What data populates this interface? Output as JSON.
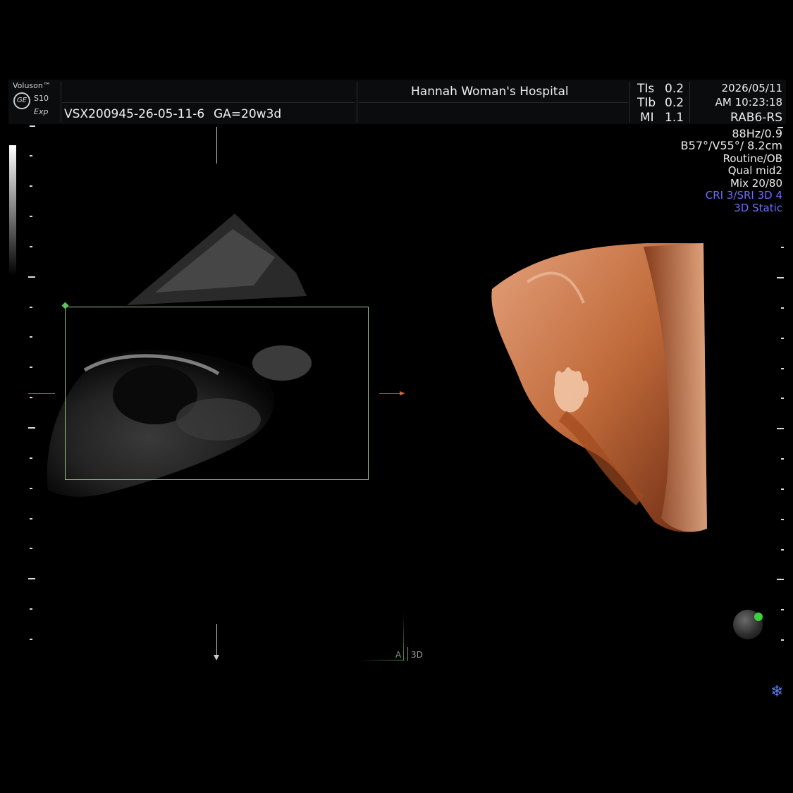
{
  "header": {
    "brand": "Voluson™",
    "model": "S10",
    "model_sub": "Exp",
    "logo": "GE",
    "patient_id": "VSX200945-26-05-11-6",
    "gestational_age": "GA=20w3d",
    "hospital": "Hannah Woman's Hospital",
    "tis_label": "TIs",
    "tis_value": "0.2",
    "tib_label": "TIb",
    "tib_value": "0.2",
    "mi_label": "MI",
    "mi_value": "1.1",
    "date": "2026/05/11",
    "time": "AM 10:23:18"
  },
  "params": {
    "probe": "RAB6-RS",
    "freq": "88Hz/0.9",
    "angles": "B57°/V55°/ 8.2cm",
    "preset": "Routine/OB",
    "quality": "Qual mid2",
    "mix": "Mix 20/80",
    "cri": "CRI 3/SRI 3D 4",
    "mode": "3D Static"
  },
  "orientation": {
    "a_label": "A",
    "d_label": "3D"
  },
  "icons": {
    "logo": "ge-logo-icon",
    "orientation": "orientation-ball-icon",
    "freeze": "snowflake-icon"
  },
  "colors": {
    "accent_blue": "#6f6cff",
    "roi_green": "#9fc18f",
    "skin": "#c06a3a"
  }
}
